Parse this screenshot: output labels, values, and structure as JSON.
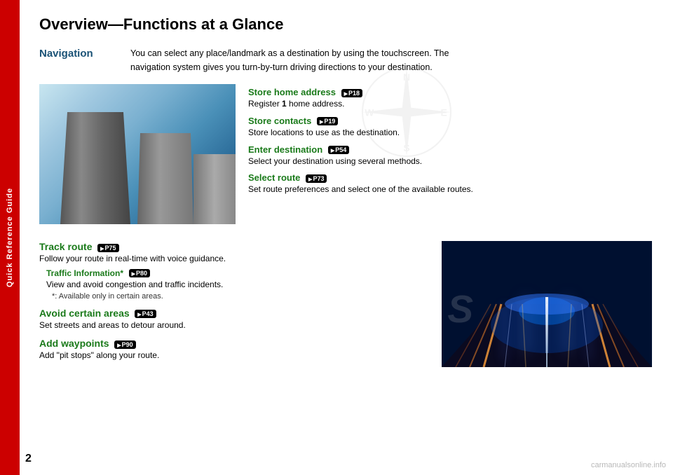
{
  "sidebar": {
    "label": "Quick Reference Guide"
  },
  "page": {
    "number": "2",
    "title": "Overview—Functions at a Glance"
  },
  "navigation_section": {
    "label": "Navigation",
    "description": "You can select any place/landmark as a destination by using the touchscreen. The navigation system gives you turn-by-turn driving directions to your destination."
  },
  "features": [
    {
      "title": "Store home address",
      "badge": "P18",
      "description": "Register 1 home address."
    },
    {
      "title": "Store contacts",
      "badge": "P19",
      "description": "Store locations to use as the destination."
    },
    {
      "title": "Enter destination",
      "badge": "P54",
      "description": "Select your destination using several methods."
    },
    {
      "title": "Select route",
      "badge": "P73",
      "description": "Set route preferences and select one of the available routes."
    }
  ],
  "bottom_features": [
    {
      "title": "Track route",
      "badge": "P75",
      "description": "Follow your route in real-time with voice guidance.",
      "sub": {
        "title": "Traffic Information*",
        "badge": "P80",
        "description": "View and avoid congestion and traffic incidents.",
        "note": "*: Available only in certain areas."
      }
    },
    {
      "title": "Avoid certain areas",
      "badge": "P43",
      "description": "Set streets and areas to detour around."
    },
    {
      "title": "Add waypoints",
      "badge": "P90",
      "description": "Add “pit stops” along your route."
    }
  ],
  "watermark": "carmanualsonline.info"
}
